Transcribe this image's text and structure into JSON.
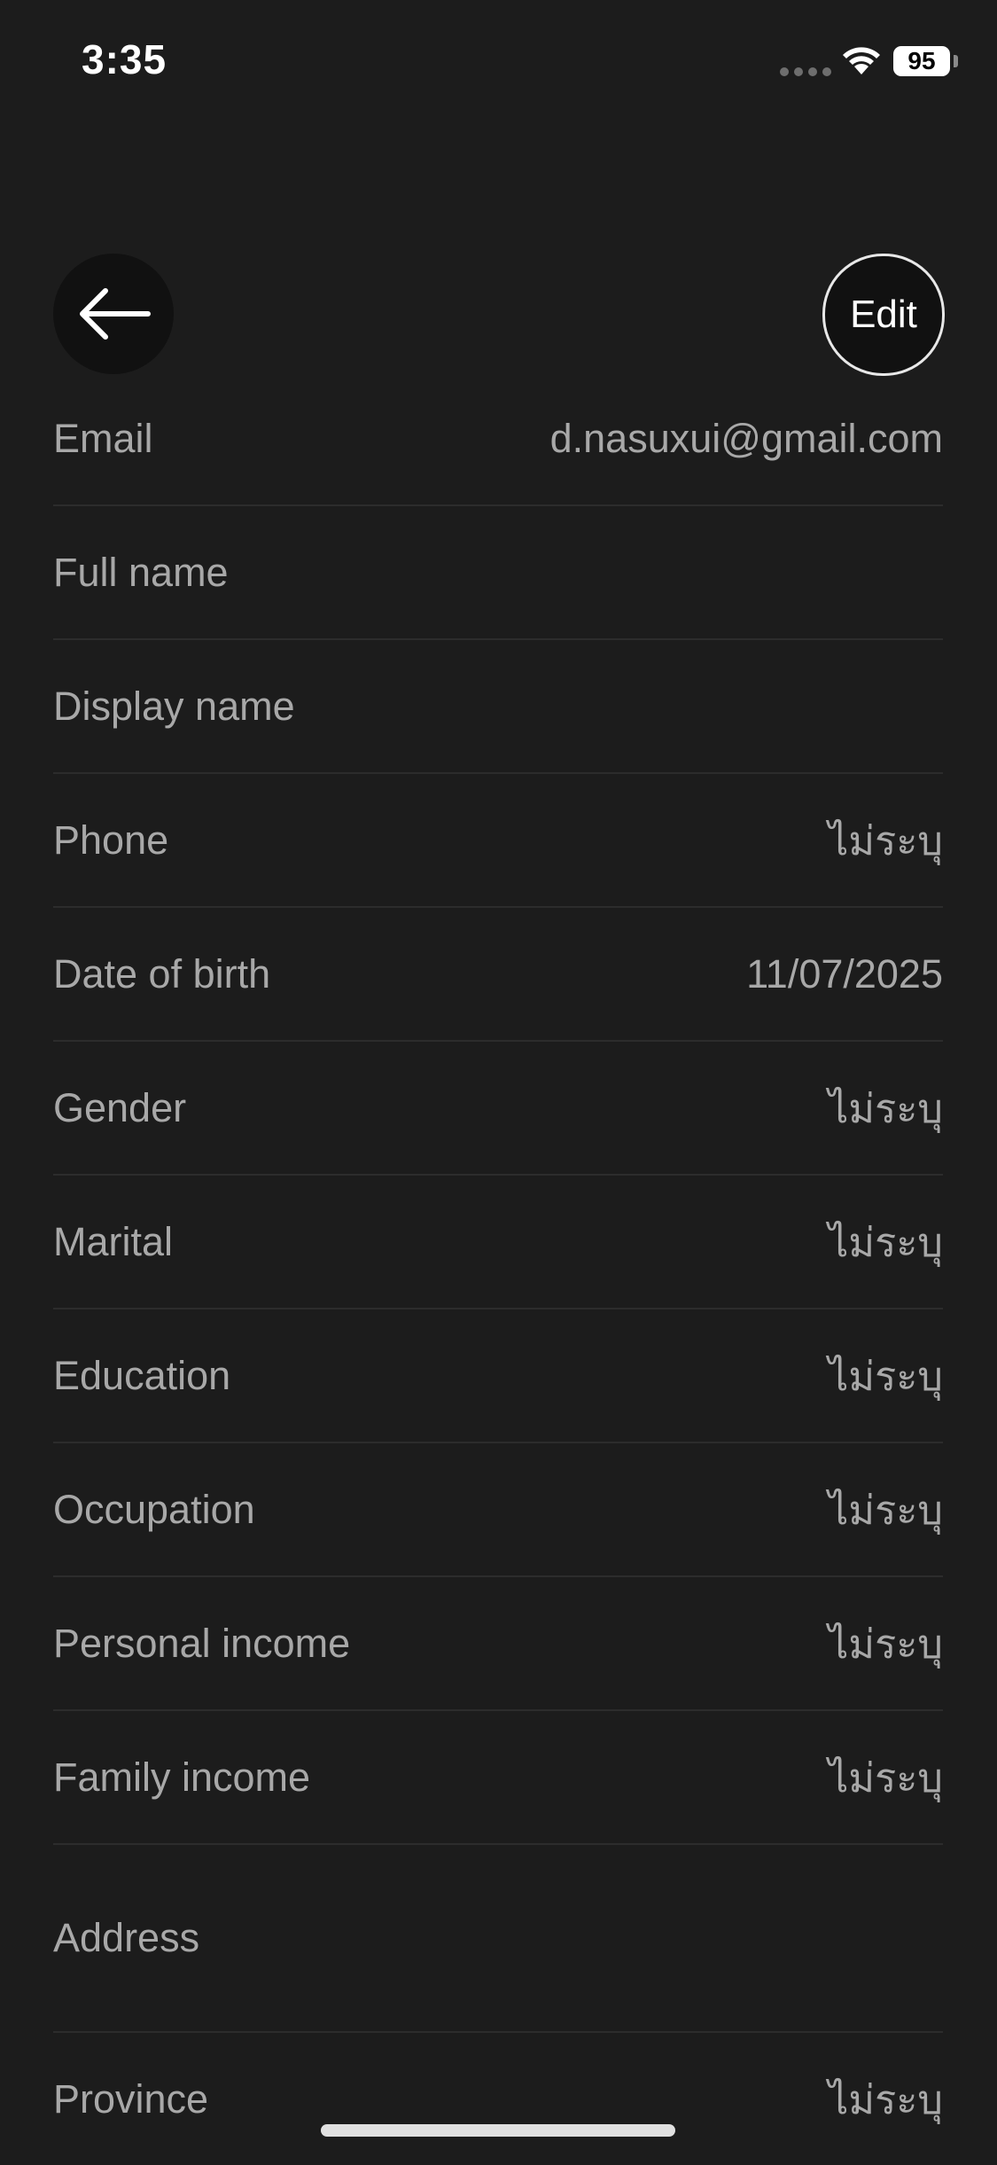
{
  "status_bar": {
    "time": "3:35",
    "battery": "95"
  },
  "header": {
    "edit_label": "Edit"
  },
  "fields": [
    {
      "label": "Email",
      "value": "d.nasuxui@gmail.com"
    },
    {
      "label": "Full name",
      "value": ""
    },
    {
      "label": "Display name",
      "value": ""
    },
    {
      "label": "Phone",
      "value": "ไม่ระบุ"
    },
    {
      "label": "Date of birth",
      "value": "11/07/2025"
    },
    {
      "label": "Gender",
      "value": "ไม่ระบุ"
    },
    {
      "label": "Marital",
      "value": "ไม่ระบุ"
    },
    {
      "label": "Education",
      "value": "ไม่ระบุ"
    },
    {
      "label": "Occupation",
      "value": "ไม่ระบุ"
    },
    {
      "label": "Personal income",
      "value": "ไม่ระบุ"
    },
    {
      "label": "Family income",
      "value": "ไม่ระบุ"
    },
    {
      "label": "Address",
      "value": ""
    },
    {
      "label": "Province",
      "value": "ไม่ระบุ"
    }
  ],
  "colors": {
    "background": "#1c1c1c",
    "text_muted": "#a8a8a8",
    "divider": "#2c2c2c"
  }
}
